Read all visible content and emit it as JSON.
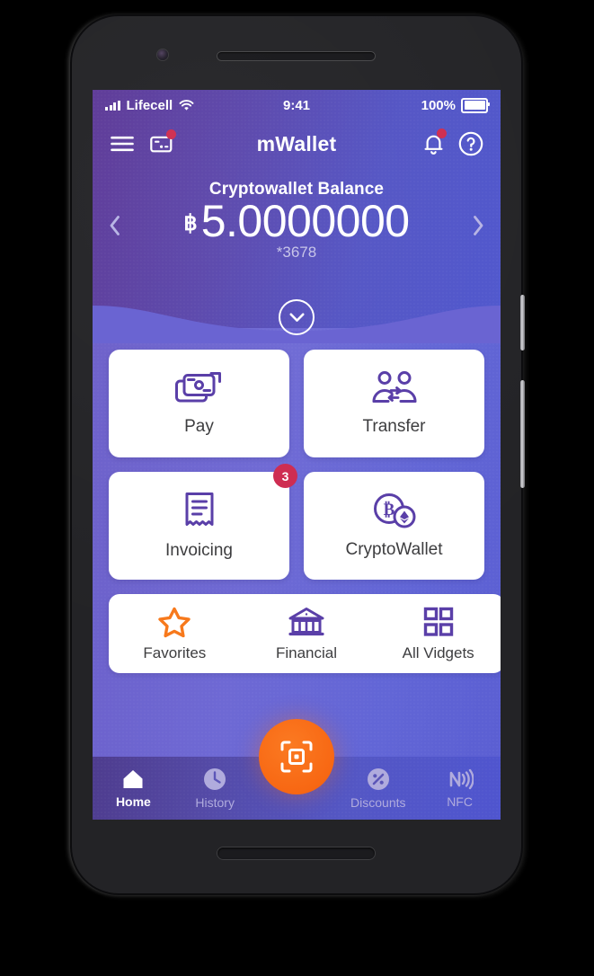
{
  "status_bar": {
    "carrier": "Lifecell",
    "signal_icon": "signal-bars-icon",
    "wifi_icon": "wifi-icon",
    "time": "9:41",
    "battery_percent": "100%",
    "battery_icon": "battery-full-icon"
  },
  "app_bar": {
    "title": "mWallet",
    "menu_icon": "hamburger-menu-icon",
    "cards_icon": "card-icon",
    "notifications_icon": "bell-icon",
    "help_icon": "question-circle-icon",
    "cards_has_badge": true,
    "notifications_has_badge": true
  },
  "balance": {
    "label": "Cryptowallet Balance",
    "currency_symbol": "฿",
    "amount": "5.0000000",
    "account_mask": "*3678",
    "prev_icon": "chevron-left-icon",
    "next_icon": "chevron-right-icon",
    "expand_icon": "chevron-down-circle-icon"
  },
  "cards": [
    {
      "label": "Pay",
      "icon": "banknote-arrow-icon",
      "badge": null
    },
    {
      "label": "Transfer",
      "icon": "people-exchange-icon",
      "badge": null
    },
    {
      "label": "Invoicing",
      "icon": "receipt-icon",
      "badge": "3"
    },
    {
      "label": "CryptoWallet",
      "icon": "bitcoin-ethereum-coins-icon",
      "badge": null
    }
  ],
  "widgets": [
    {
      "label": "Favorites",
      "icon": "star-icon"
    },
    {
      "label": "Financial",
      "icon": "bank-icon"
    },
    {
      "label": "All Vidgets",
      "icon": "grid-squares-icon"
    }
  ],
  "tab_bar": {
    "items": [
      {
        "label": "Home",
        "icon": "home-icon",
        "active": true
      },
      {
        "label": "History",
        "icon": "clock-icon",
        "active": false
      },
      {
        "label": "Discounts",
        "icon": "percent-icon",
        "active": false
      },
      {
        "label": "NFC",
        "icon": "nfc-icon",
        "active": false
      }
    ],
    "scan_button_icon": "qr-scan-icon"
  },
  "colors": {
    "header_purple": "#5c3896",
    "header_blue": "#4f57cd",
    "body_violet": "#6e69d4",
    "accent_orange": "#f86a15",
    "badge_crimson": "#ce2d52",
    "icon_purple": "#5a3fa8",
    "card_white": "#ffffff"
  }
}
